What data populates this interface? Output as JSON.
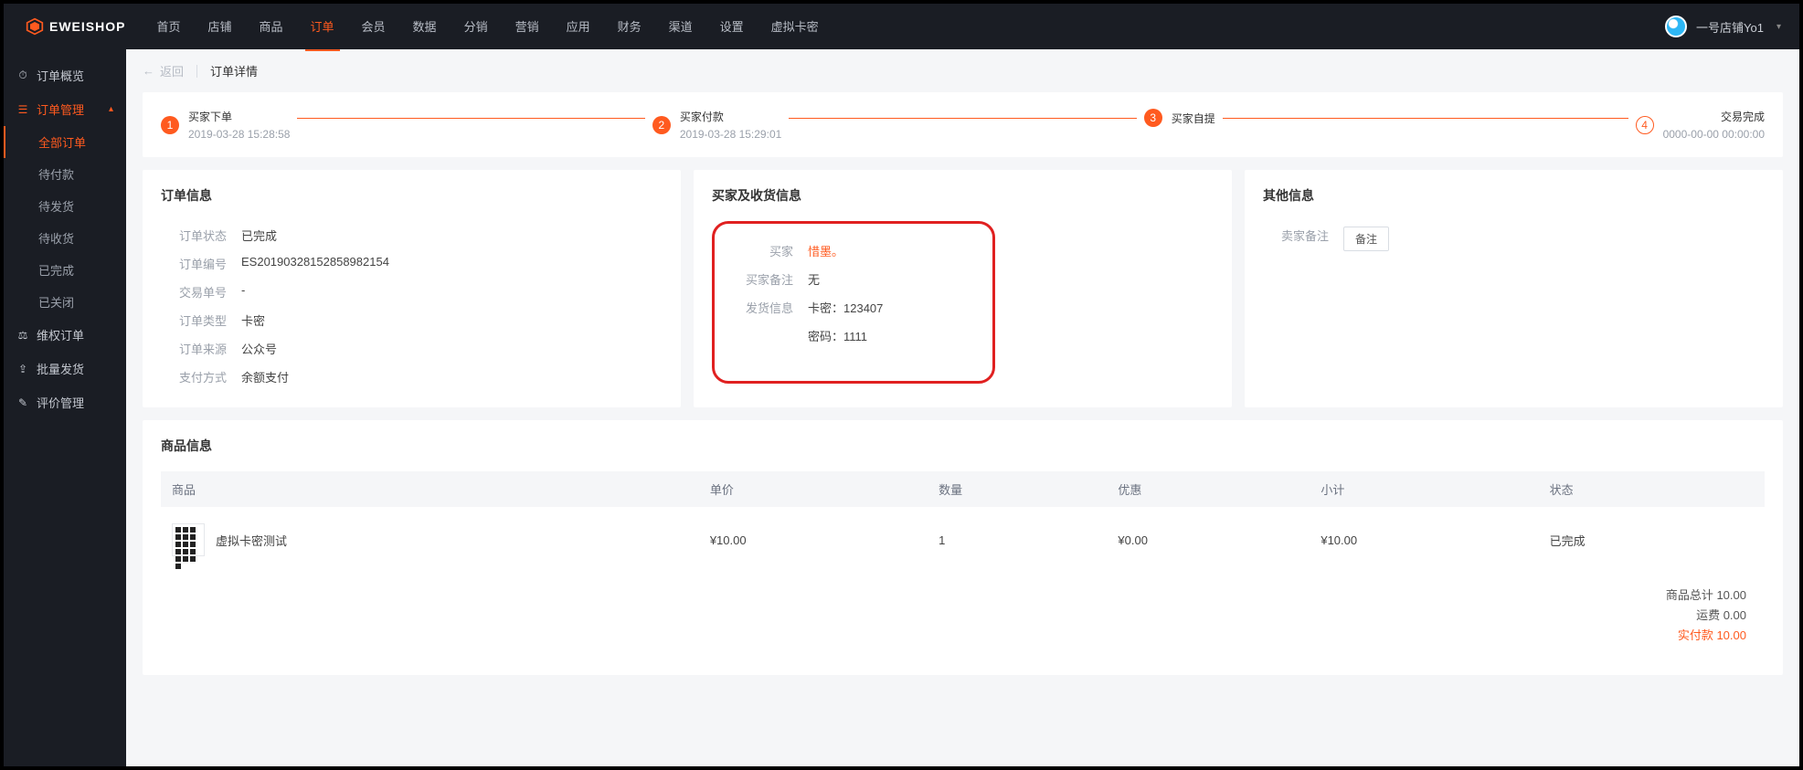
{
  "brand": "EWEISHOP",
  "nav": [
    "首页",
    "店铺",
    "商品",
    "订单",
    "会员",
    "数据",
    "分销",
    "营销",
    "应用",
    "财务",
    "渠道",
    "设置",
    "虚拟卡密"
  ],
  "nav_active_index": 3,
  "user": {
    "shop": "一号店铺Yo1"
  },
  "sidebar": {
    "groups": [
      {
        "icon": "⏱",
        "label": "订单概览",
        "type": "item"
      },
      {
        "icon": "☰",
        "label": "订单管理",
        "type": "expand",
        "children": [
          "全部订单",
          "待付款",
          "待发货",
          "待收货",
          "已完成",
          "已关闭"
        ],
        "active_child": 0
      },
      {
        "icon": "⚖",
        "label": "维权订单",
        "type": "item"
      },
      {
        "icon": "⇪",
        "label": "批量发货",
        "type": "item"
      },
      {
        "icon": "✎",
        "label": "评价管理",
        "type": "item"
      }
    ]
  },
  "crumb": {
    "back": "返回",
    "title": "订单详情"
  },
  "steps": [
    {
      "n": "1",
      "title": "买家下单",
      "sub": "2019-03-28 15:28:58"
    },
    {
      "n": "2",
      "title": "买家付款",
      "sub": "2019-03-28 15:29:01"
    },
    {
      "n": "3",
      "title": "买家自提",
      "sub": ""
    },
    {
      "n": "4",
      "title": "交易完成",
      "sub": "0000-00-00 00:00:00"
    }
  ],
  "order_info": {
    "title": "订单信息",
    "rows": [
      {
        "k": "订单状态",
        "v": "已完成"
      },
      {
        "k": "订单编号",
        "v": "ES20190328152858982154"
      },
      {
        "k": "交易单号",
        "v": "-"
      },
      {
        "k": "订单类型",
        "v": "卡密"
      },
      {
        "k": "订单来源",
        "v": "公众号"
      },
      {
        "k": "支付方式",
        "v": "余额支付"
      }
    ]
  },
  "buyer_info": {
    "title": "买家及收货信息",
    "rows": [
      {
        "k": "买家",
        "v": "惜墨。",
        "orange": true
      },
      {
        "k": "买家备注",
        "v": "无"
      },
      {
        "k": "发货信息",
        "v": "卡密：123407"
      },
      {
        "k": "",
        "v": "密码：1111"
      }
    ]
  },
  "other_info": {
    "title": "其他信息",
    "seller_note_k": "卖家备注",
    "note_btn": "备注"
  },
  "products": {
    "title": "商品信息",
    "headers": [
      "商品",
      "单价",
      "数量",
      "优惠",
      "小计",
      "状态"
    ],
    "row": {
      "name": "虚拟卡密测试",
      "price": "¥10.00",
      "qty": "1",
      "discount": "¥0.00",
      "subtotal": "¥10.00",
      "status": "已完成"
    }
  },
  "totals": {
    "goods": "商品总计 10.00",
    "ship": "运费 0.00",
    "pay": "实付款 10.00"
  }
}
